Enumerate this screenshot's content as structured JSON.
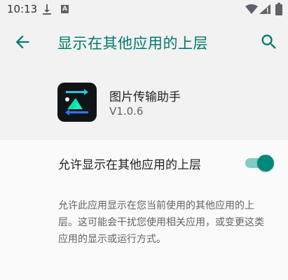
{
  "status_bar": {
    "time": "10:13",
    "notification_icons": [
      "download-icon",
      "a-icon"
    ],
    "system_icons": [
      "wifi-icon",
      "signal-icon",
      "battery-icon"
    ]
  },
  "header": {
    "title": "显示在其他应用的上层",
    "back_icon": "arrow-left-icon",
    "search_icon": "search-icon"
  },
  "app": {
    "name": "图片传输助手",
    "version": "V1.0.6"
  },
  "setting": {
    "label": "允许显示在其他应用的上层",
    "enabled": true
  },
  "description": "允许此应用显示在您当前使用的其他应用的上层。这可能会干扰您使用相关应用，或变更这类应用的显示或运行方式。",
  "colors": {
    "accent": "#00796b",
    "toggle_thumb": "#00897b",
    "toggle_track": "#80cbc4",
    "header_bg": "#f2f2f2",
    "body_bg": "#fafafa"
  }
}
